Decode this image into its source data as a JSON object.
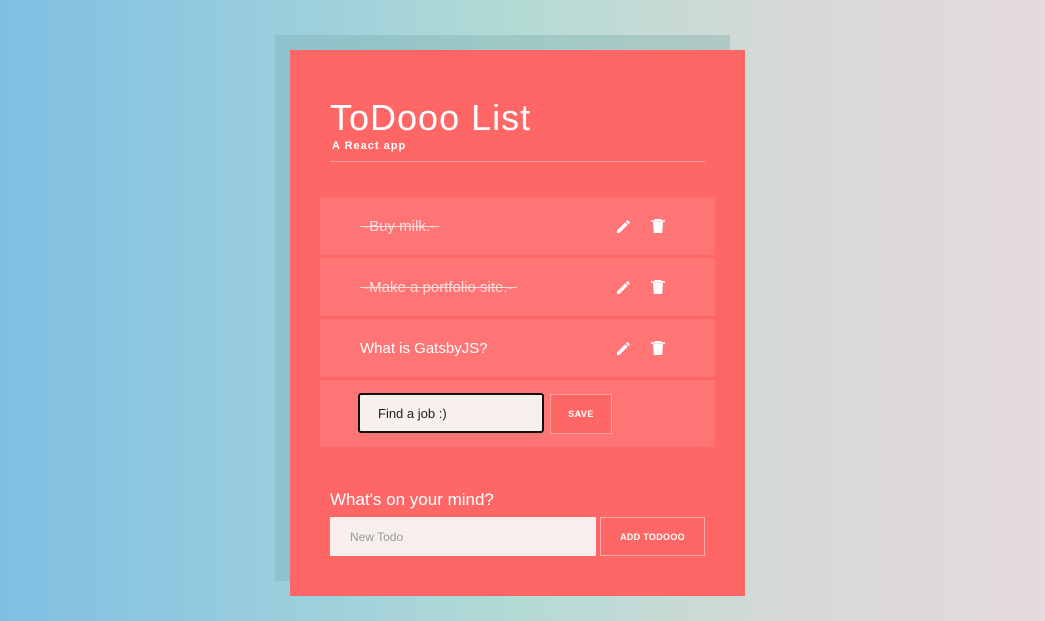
{
  "header": {
    "title": "ToDooo List",
    "subtitle": "A React app"
  },
  "todos": [
    {
      "text": "Buy milk.",
      "completed": true
    },
    {
      "text": "Make a portfolio site.",
      "completed": true
    },
    {
      "text": "What is GatsbyJS?",
      "completed": false
    }
  ],
  "icons": {
    "edit": "pencil-icon",
    "delete": "trash-icon"
  },
  "editing": {
    "value": "Find a job :)",
    "save_label": "SAVE"
  },
  "composer": {
    "label": "What's on your mind?",
    "placeholder": "New Todo",
    "add_label": "ADD TODOOO"
  },
  "colors": {
    "card": "#ff6767",
    "item": "#ff7474",
    "accent_text": "#ffffff"
  }
}
